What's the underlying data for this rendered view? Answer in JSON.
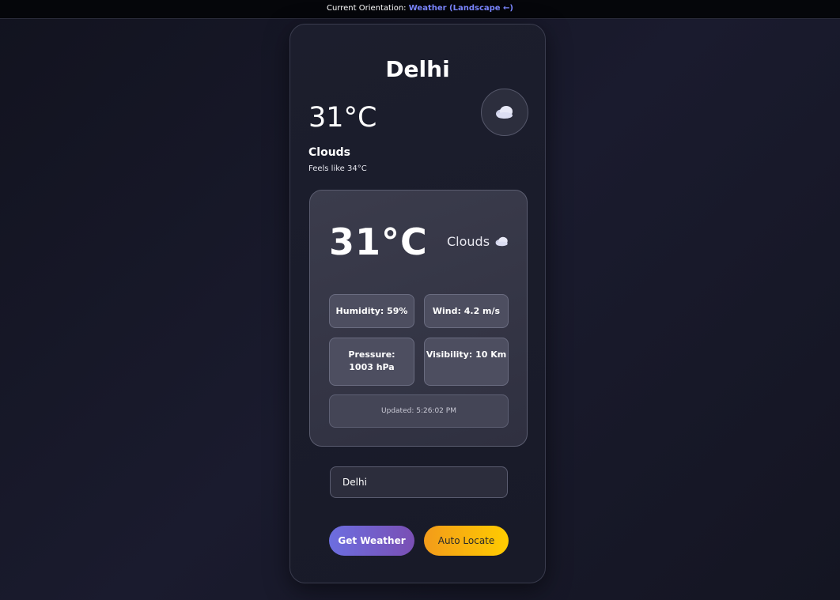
{
  "header": {
    "label": "Current Orientation:",
    "value": "Weather (Landscape ←)"
  },
  "weather": {
    "city": "Delhi",
    "temperature": "31°C",
    "condition": "Clouds",
    "feels_like": "Feels like 34°C",
    "icon": "cloud-icon"
  },
  "details": {
    "temperature": "31°C",
    "condition": "Clouds",
    "humidity": "Humidity: 59%",
    "wind": "Wind: 4.2 m/s",
    "pressure": "Pressure: 1003 hPa",
    "visibility": "Visibility: 10 Km",
    "updated": "Updated: 5:26:02 PM"
  },
  "search": {
    "value": "Delhi"
  },
  "buttons": {
    "get_weather": "Get Weather",
    "auto_locate": "Auto Locate"
  },
  "colors": {
    "accent": "#7b86ff",
    "get_weather_start": "#6c6ee0",
    "get_weather_end": "#7a4fb4",
    "auto_locate_start": "#f39b1a",
    "auto_locate_end": "#ffcc00"
  }
}
